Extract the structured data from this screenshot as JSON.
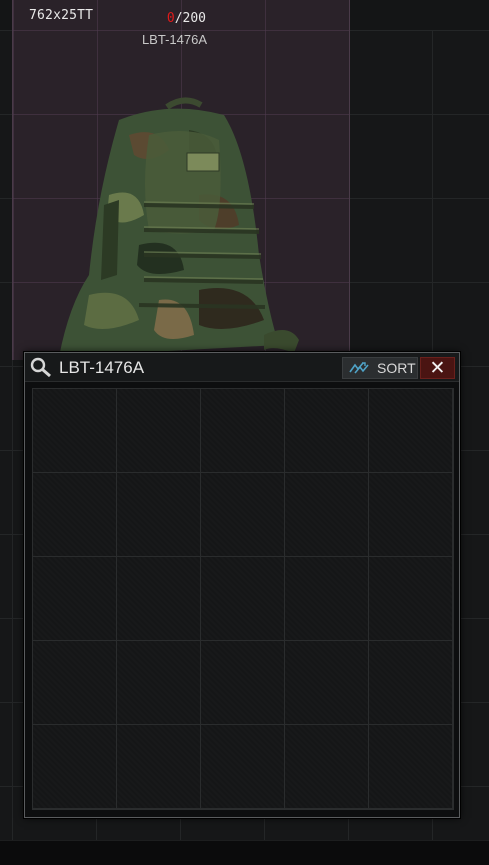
{
  "stash": {
    "ammo_label": "762x25TT",
    "capacity_current": "0",
    "capacity_max": "/200",
    "item_short_name": "LBT-1476A",
    "item_icon": "woodland-camo-backpack"
  },
  "search_window": {
    "title": "LBT-1476A",
    "sort_label": "SORT",
    "close_label": "✕",
    "grid_columns": 5,
    "grid_rows": 5
  },
  "colors": {
    "capacity_current": "#e11a1a",
    "item_highlight": "#2a2229",
    "close_button": "#4a1412"
  }
}
